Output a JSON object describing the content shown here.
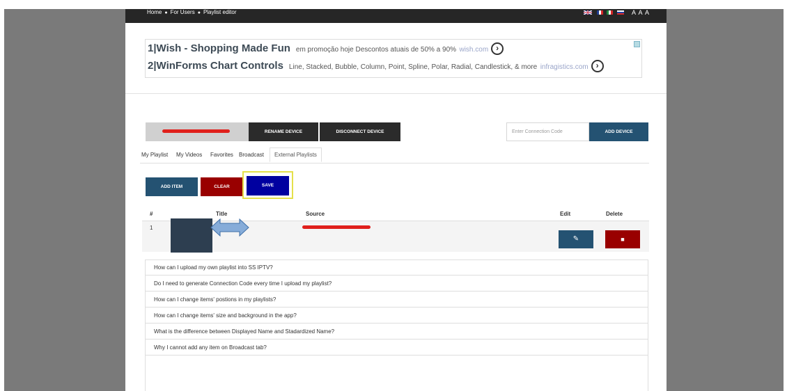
{
  "breadcrumb": [
    "Home",
    "For Users",
    "Playlist editor"
  ],
  "font_size_controls": "A A A",
  "ads": [
    {
      "num": "1",
      "title": "Wish - Shopping Made Fun",
      "desc": "em promoção hoje Descontos atuais de 50% a 90%",
      "domain": "wish.com"
    },
    {
      "num": "2",
      "title": "WinForms Chart Controls",
      "desc": "Line, Stacked, Bubble, Column, Point, Spline, Polar, Radial, Candlestick, & more",
      "domain": "infragistics.com"
    }
  ],
  "device": {
    "rename_label": "RENAME DEVICE",
    "disconnect_label": "DISCONNECT DEVICE",
    "connection_placeholder": "Enter Connection Code",
    "add_label": "ADD DEVICE"
  },
  "tabs": [
    "My Playlist",
    "My Videos",
    "Favorites",
    "Broadcast",
    "External Playlists"
  ],
  "active_tab": "External Playlists",
  "actions": {
    "add_item": "ADD ITEM",
    "clear": "CLEAR",
    "save": "SAVE"
  },
  "table": {
    "headers": [
      "#",
      "Title",
      "Source",
      "Edit",
      "Delete"
    ],
    "rows": [
      {
        "num": "1"
      }
    ]
  },
  "faq": [
    "How can I upload my own playlist into SS IPTV?",
    "Do I need to generate Connection Code every time I upload my playlist?",
    "How can I change items' postions in my playlists?",
    "How can I change items' size and background in the app?",
    "What is the difference between Displayed Name and Stadardized Name?",
    "Why I cannot add any item on Broadcast tab?"
  ],
  "colors": {
    "topbar": "#262626",
    "primary": "#245272",
    "danger": "#990000",
    "save": "#0000a0",
    "highlight": "#e5e04a",
    "redaction": "#e0201c"
  }
}
